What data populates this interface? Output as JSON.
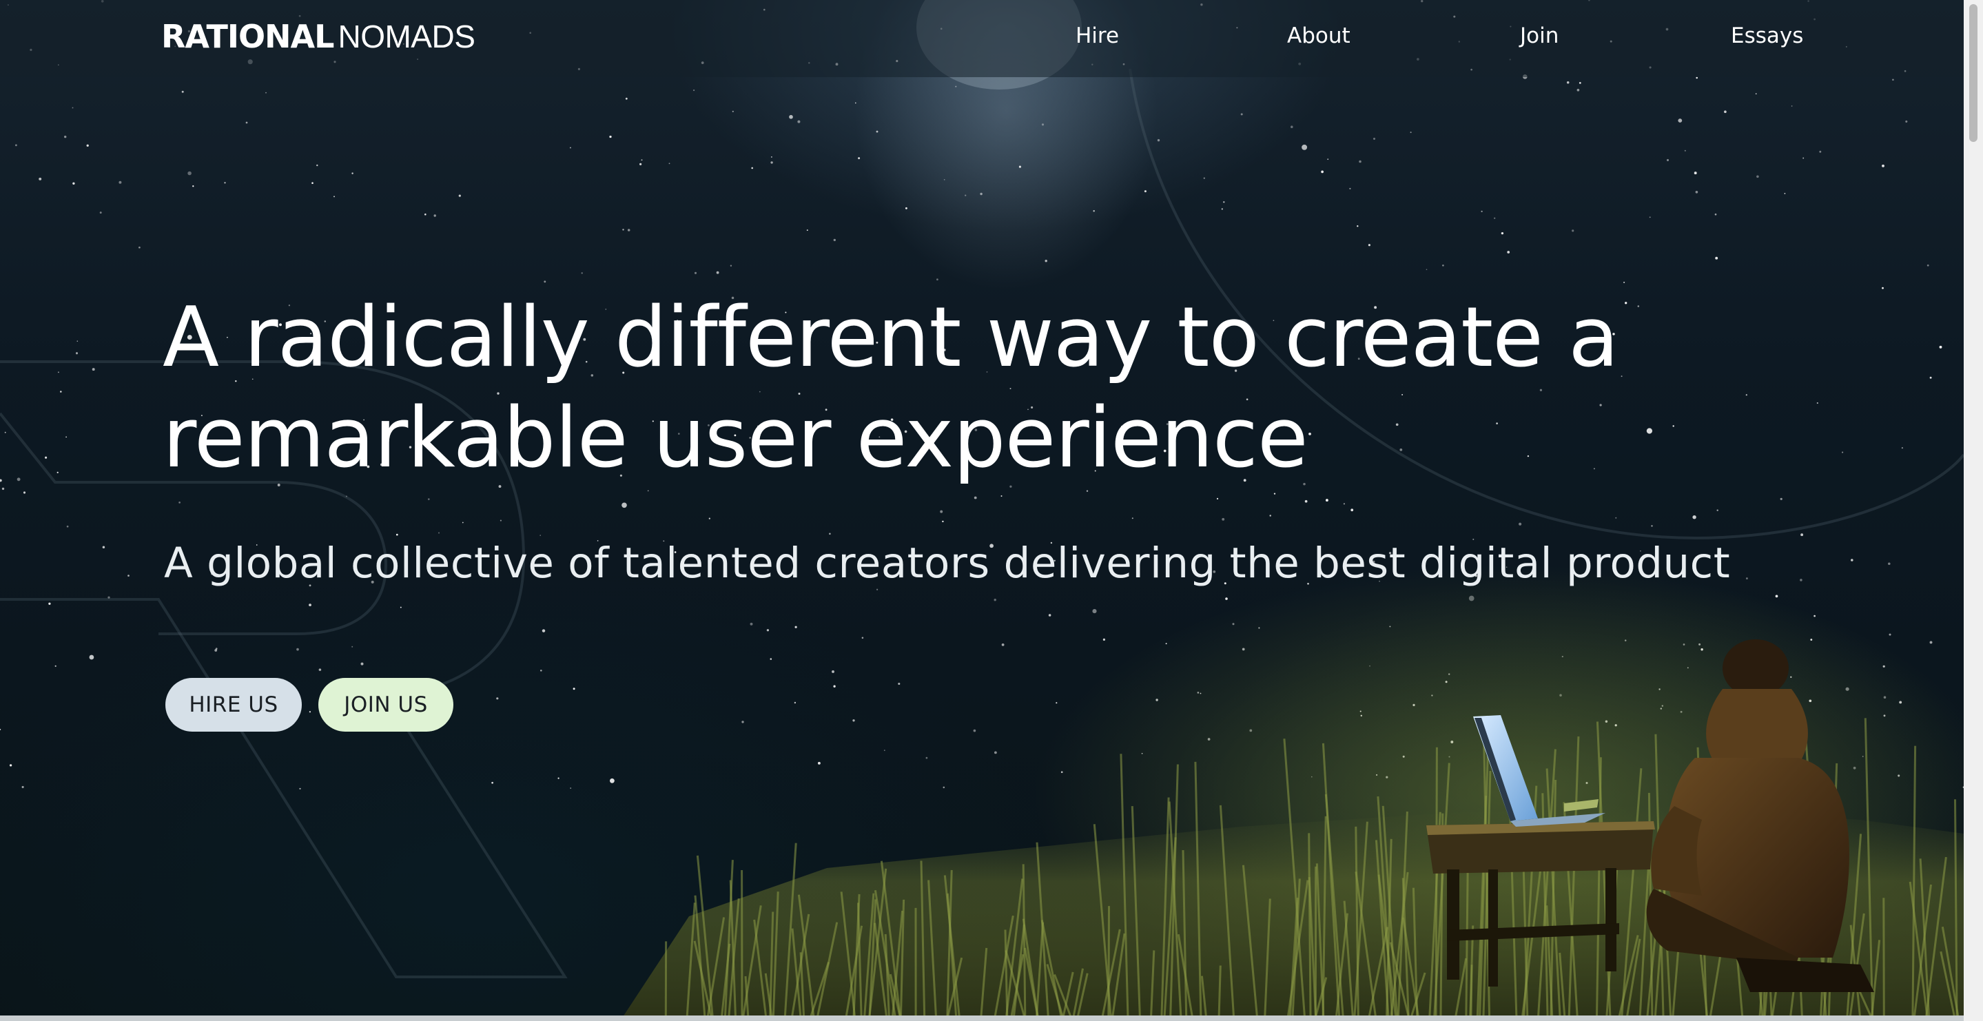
{
  "brand": {
    "logo_bold": "RATIONAL",
    "logo_light": "NOMADS"
  },
  "nav": {
    "links": [
      {
        "label": "Hire"
      },
      {
        "label": "About"
      },
      {
        "label": "Join"
      },
      {
        "label": "Essays"
      }
    ]
  },
  "hero": {
    "title_line1": "A radically different way to create a",
    "title_line2": "remarkable user experience",
    "subtitle": "A global collective of talented creators delivering the best digital product",
    "buttons": {
      "hire_label": "HIRE US",
      "join_label": "JOIN US"
    }
  },
  "colors": {
    "text": "#ffffff",
    "hire_button_bg": "#d6e0e8",
    "join_button_bg": "#dff3d4",
    "sky": "#0d1923"
  }
}
